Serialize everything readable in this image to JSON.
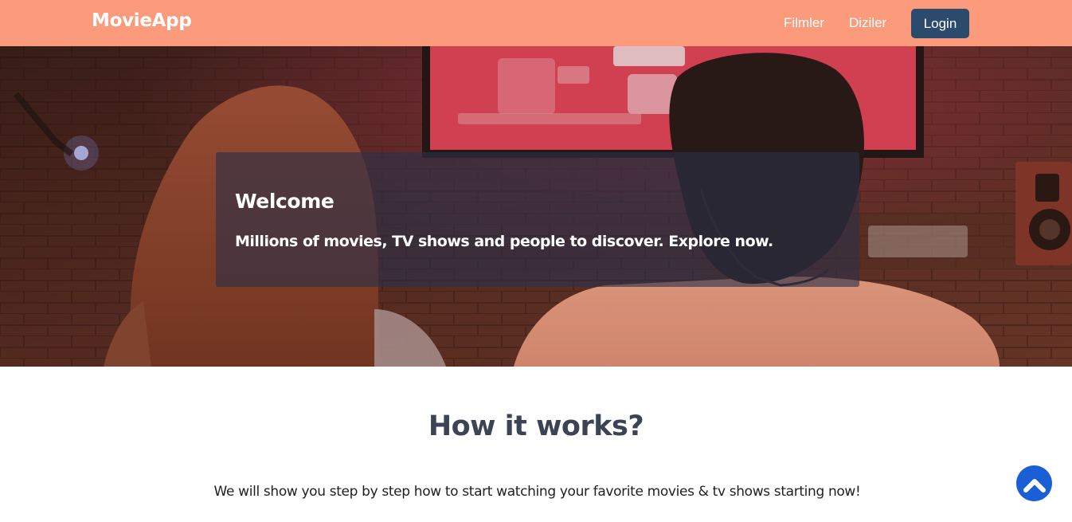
{
  "navbar": {
    "brand": "MovieApp",
    "links": [
      {
        "label": "Filmler"
      },
      {
        "label": "Diziler"
      }
    ],
    "login_label": "Login"
  },
  "hero": {
    "title": "Welcome",
    "subtitle": "Millions of movies, TV shows and people to discover. Explore now."
  },
  "how_it_works": {
    "title": "How it works?",
    "description": "We will show you step by step how to start watching your favorite movies & tv shows starting now!"
  },
  "scroll_top": {
    "icon": "chevron-up-icon"
  },
  "colors": {
    "navbar": "#fc9a7c",
    "login_button": "#2c4a6b",
    "scroll_top_button": "#1a5fd6",
    "heading_text": "#3b4354"
  }
}
